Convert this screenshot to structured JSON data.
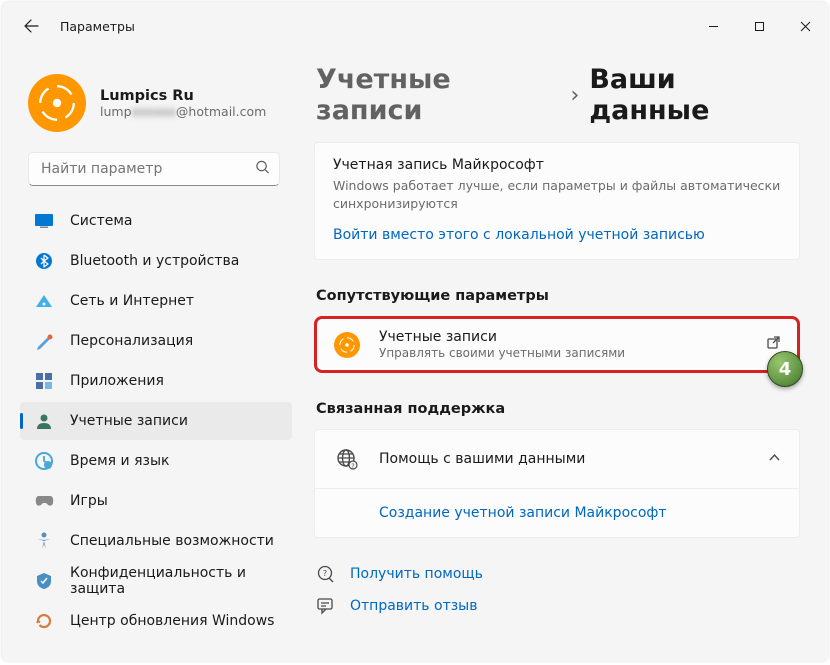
{
  "titlebar": {
    "label": "Параметры"
  },
  "profile": {
    "name": "Lumpics Ru",
    "email_prefix": "lump",
    "email_blur": "xxxxxx",
    "email_suffix": "@hotmail.com"
  },
  "search": {
    "placeholder": "Найти параметр"
  },
  "nav": {
    "items": [
      {
        "label": "Система"
      },
      {
        "label": "Bluetooth и устройства"
      },
      {
        "label": "Сеть и Интернет"
      },
      {
        "label": "Персонализация"
      },
      {
        "label": "Приложения"
      },
      {
        "label": "Учетные записи"
      },
      {
        "label": "Время и язык"
      },
      {
        "label": "Игры"
      },
      {
        "label": "Специальные возможности"
      },
      {
        "label": "Конфиденциальность и защита"
      },
      {
        "label": "Центр обновления Windows"
      }
    ]
  },
  "breadcrumb": {
    "parent": "Учетные записи",
    "current": "Ваши данные"
  },
  "ms_card": {
    "title": "Учетная запись Майкрософт",
    "desc": "Windows работает лучше, если параметры и файлы автоматически синхронизируются",
    "link": "Войти вместо этого с локальной учетной записью"
  },
  "related": {
    "header": "Сопутствующие параметры",
    "row": {
      "title": "Учетные записи",
      "desc": "Управлять своими учетными записями"
    },
    "badge": "4"
  },
  "support": {
    "header": "Связанная поддержка",
    "row_title": "Помощь с вашими данными",
    "link": "Создание учетной записи Майкрософт"
  },
  "footer": {
    "help": "Получить помощь",
    "feedback": "Отправить отзыв"
  }
}
